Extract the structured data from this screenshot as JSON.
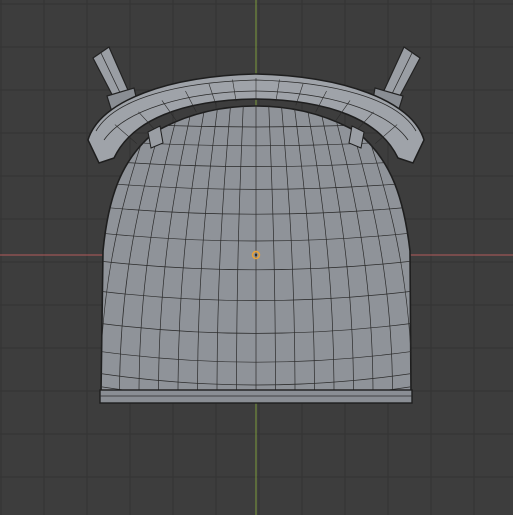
{
  "viewport": {
    "view": "top-orthographic",
    "grid": true,
    "axis_x_color": "#b35a5a",
    "axis_y_color": "#7a9a3a",
    "background_color": "#3d3d3d",
    "grid_color": "#333333",
    "mesh_face_color": "#8f9399",
    "mesh_wire_color": "#2a2a2a",
    "origin_color": "#e8a23a"
  },
  "object": {
    "name": "chair-mesh",
    "selected": false
  }
}
